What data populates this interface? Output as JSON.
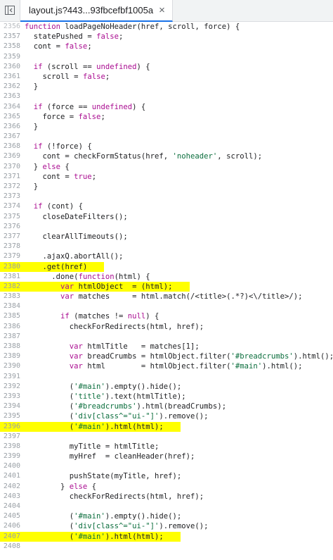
{
  "tab": {
    "title": "layout.js?443...93fbcefbf1005a",
    "close_glyph": "×"
  },
  "code": {
    "lines": [
      {
        "n": "2356",
        "t": "function loadPageNoHeader(href, scroll, force) {"
      },
      {
        "n": "2357",
        "t": "  statePushed = false;"
      },
      {
        "n": "2358",
        "t": "  cont = false;"
      },
      {
        "n": "2359",
        "t": ""
      },
      {
        "n": "2360",
        "t": "  if (scroll == undefined) {"
      },
      {
        "n": "2361",
        "t": "    scroll = false;"
      },
      {
        "n": "2362",
        "t": "  }"
      },
      {
        "n": "2363",
        "t": ""
      },
      {
        "n": "2364",
        "t": "  if (force == undefined) {"
      },
      {
        "n": "2365",
        "t": "    force = false;"
      },
      {
        "n": "2366",
        "t": "  }"
      },
      {
        "n": "2367",
        "t": ""
      },
      {
        "n": "2368",
        "t": "  if (!force) {"
      },
      {
        "n": "2369",
        "t": "    cont = checkFormStatus(href, 'noheader', scroll);"
      },
      {
        "n": "2370",
        "t": "  } else {"
      },
      {
        "n": "2371",
        "t": "    cont = true;"
      },
      {
        "n": "2372",
        "t": "  }"
      },
      {
        "n": "2373",
        "t": ""
      },
      {
        "n": "2374",
        "t": "  if (cont) {"
      },
      {
        "n": "2375",
        "t": "    closeDateFilters();"
      },
      {
        "n": "2376",
        "t": ""
      },
      {
        "n": "2377",
        "t": "    clearAllTimeouts();"
      },
      {
        "n": "2378",
        "t": ""
      },
      {
        "n": "2379",
        "t": "    $.ajaxQ.abortAll();"
      },
      {
        "n": "2380",
        "t": "    $.get(href)"
      },
      {
        "n": "2381",
        "t": "      .done(function(html) {"
      },
      {
        "n": "2382",
        "t": "        var htmlObject  = $(html);"
      },
      {
        "n": "2383",
        "t": "        var matches     = html.match(/<title>(.*?)<\\/title>/);"
      },
      {
        "n": "2384",
        "t": ""
      },
      {
        "n": "2385",
        "t": "        if (matches != null) {"
      },
      {
        "n": "2386",
        "t": "          checkForRedirects(html, href);"
      },
      {
        "n": "2387",
        "t": ""
      },
      {
        "n": "2388",
        "t": "          var htmlTitle   = matches[1];"
      },
      {
        "n": "2389",
        "t": "          var breadCrumbs = htmlObject.filter('#breadcrumbs').html();"
      },
      {
        "n": "2390",
        "t": "          var html        = htmlObject.filter('#main').html();"
      },
      {
        "n": "2391",
        "t": ""
      },
      {
        "n": "2392",
        "t": "          $('#main').empty().hide();"
      },
      {
        "n": "2393",
        "t": "          $('title').text(htmlTitle);"
      },
      {
        "n": "2394",
        "t": "          $('#breadcrumbs').html(breadCrumbs);"
      },
      {
        "n": "2395",
        "t": "          $('div[class^=\"ui-\"]').remove();"
      },
      {
        "n": "2396",
        "t": "          $('#main').html(html);"
      },
      {
        "n": "2397",
        "t": ""
      },
      {
        "n": "2398",
        "t": "          myTitle = htmlTitle;"
      },
      {
        "n": "2399",
        "t": "          myHref  = cleanHeader(href);"
      },
      {
        "n": "2400",
        "t": ""
      },
      {
        "n": "2401",
        "t": "          pushState(myTitle, href);"
      },
      {
        "n": "2402",
        "t": "        } else {"
      },
      {
        "n": "2403",
        "t": "          checkForRedirects(html, href);"
      },
      {
        "n": "2404",
        "t": ""
      },
      {
        "n": "2405",
        "t": "          $('#main').empty().hide();"
      },
      {
        "n": "2406",
        "t": "          $('div[class^=\"ui-\"]').remove();"
      },
      {
        "n": "2407",
        "t": "          $('#main').html(html);"
      },
      {
        "n": "2408",
        "t": ""
      }
    ],
    "highlighted_lines": [
      "2380",
      "2382",
      "2396",
      "2407"
    ],
    "colors": {
      "highlight": "#ffff00",
      "keyword": "#aa0d91",
      "function": "#1c00cf",
      "string": "#0b6e3d",
      "line_number": "#9aa0a6"
    }
  },
  "icons": {
    "panel_toggle": "sidebar-toggle-icon"
  }
}
